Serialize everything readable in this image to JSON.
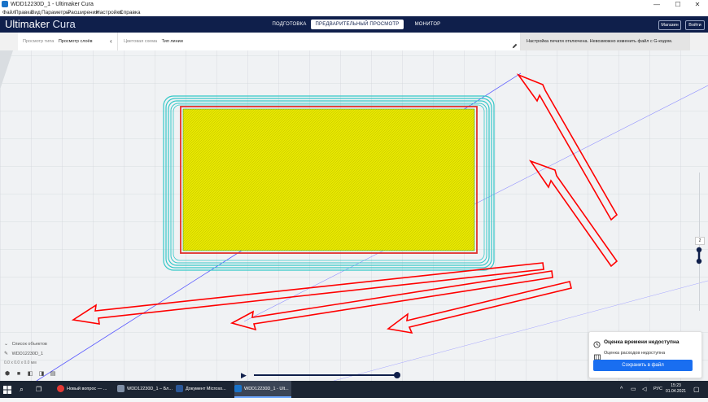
{
  "window": {
    "title": "WDD12230D_1 - Ultimaker Cura",
    "minimize": "—",
    "maximize": "☐",
    "close": "✕"
  },
  "menu": [
    "Файл",
    "Правка",
    "Вид",
    "Параметры",
    "Расширения",
    "Настройки",
    "Справка"
  ],
  "header": {
    "logo_part1": "Ultimaker",
    "logo_part2": "Cura",
    "tabs": [
      "ПОДГОТОВКА",
      "ПРЕДВАРИТЕЛЬНЫЙ ПРОСМОТР",
      "МОНИТОР"
    ],
    "active_tab": "ПРЕДВАРИТЕЛЬНЫЙ ПРОСМОТР",
    "marketplace_button": "Магазин",
    "login_button": "Войти"
  },
  "view_settings": {
    "view_type_label": "Просмотр типа",
    "view_type_value": "Просмотр слоёв",
    "color_scheme_label": "Цветовая схема",
    "color_scheme_value": "Тип линии",
    "collapse_icon": "‹",
    "edit_icon": "pencil-icon"
  },
  "message": "Настройка печати отключена. Невозможно изменить файл с G-кодом.",
  "layer_slider": {
    "current_layer": "2"
  },
  "objects": {
    "header": "Список объектов",
    "item": "WDD12230D_1",
    "dimensions": "0.0 x 0.0 x 0.0 мм"
  },
  "playback": {
    "play_icon": "▶",
    "progress": 1.0
  },
  "estimate": {
    "title": "Оценка времени недоступна",
    "material": "Оценка расходов недоступна",
    "save_button": "Сохранить в файл"
  },
  "taskbar": {
    "items": [
      {
        "label": "Новый вопрос — ...",
        "icon_color": "#e53935"
      },
      {
        "label": "WDD12230D_1 – Бл...",
        "icon_color": "#7f8fa6"
      },
      {
        "label": "Документ Microso...",
        "icon_color": "#2b5797"
      },
      {
        "label": "WDD12230D_1 - Ult...",
        "icon_color": "#1a73c8"
      }
    ],
    "language": "РУС",
    "time": "15:23",
    "date": "01.04.2021"
  },
  "colors": {
    "header_bg": "#0f1f4b",
    "skirt": "#35c8c8",
    "wall": "#e0302a",
    "infill": "#e6e600",
    "accent": "#196ef0",
    "annotation": "#ff0000"
  }
}
